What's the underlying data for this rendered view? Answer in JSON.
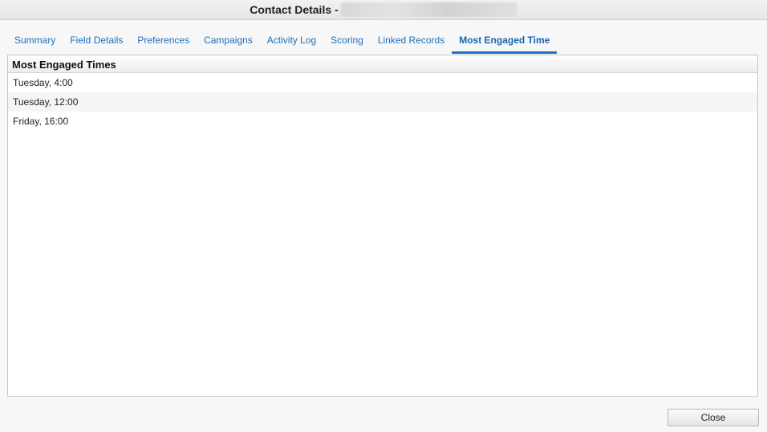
{
  "window": {
    "title": "Contact Details"
  },
  "tabs": [
    {
      "label": "Summary"
    },
    {
      "label": "Field Details"
    },
    {
      "label": "Preferences"
    },
    {
      "label": "Campaigns"
    },
    {
      "label": "Activity Log"
    },
    {
      "label": "Scoring"
    },
    {
      "label": "Linked Records"
    },
    {
      "label": "Most Engaged Time",
      "active": true
    }
  ],
  "panel": {
    "header": "Most Engaged Times",
    "rows": [
      {
        "text": "Tuesday, 4:00"
      },
      {
        "text": "Tuesday, 12:00"
      },
      {
        "text": "Friday, 16:00"
      }
    ]
  },
  "footer": {
    "close_label": "Close"
  },
  "colors": {
    "accent": "#1a73c6",
    "tab_text": "#1d6fb8"
  }
}
